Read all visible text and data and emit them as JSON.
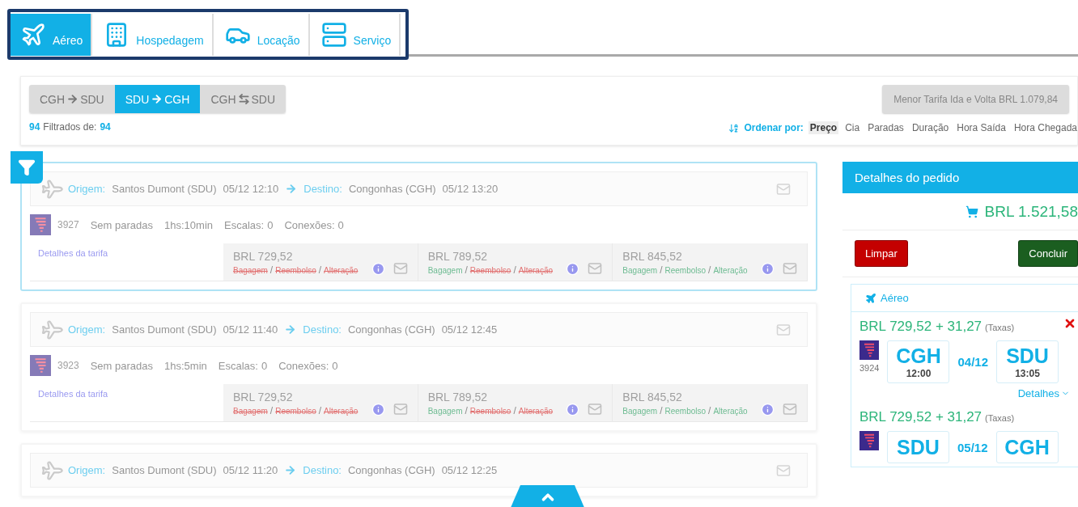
{
  "product_tabs": [
    {
      "label": "Aéreo",
      "kind": "plane",
      "selected": true
    },
    {
      "label": "Hospedagem",
      "kind": "building",
      "selected": false
    },
    {
      "label": "Locação",
      "kind": "car",
      "selected": false
    },
    {
      "label": "Serviço",
      "kind": "server",
      "selected": false
    }
  ],
  "routes": [
    {
      "from": "CGH",
      "to": "SDU",
      "kind": "oneway",
      "selected": false
    },
    {
      "from": "SDU",
      "to": "CGH",
      "kind": "oneway",
      "selected": true
    },
    {
      "from": "CGH",
      "to": "SDU",
      "kind": "roundtrip",
      "selected": false
    }
  ],
  "filter_count": {
    "shown": "94",
    "label": "Filtrados de:",
    "total": "94"
  },
  "lowest_fare_button": "Menor Tarifa Ida e Volta BRL 1.079,84",
  "sort": {
    "label": "Ordenar por:",
    "options": [
      {
        "label": "Preço",
        "selected": true
      },
      {
        "label": "Cia",
        "selected": false
      },
      {
        "label": "Paradas",
        "selected": false
      },
      {
        "label": "Duração",
        "selected": false
      },
      {
        "label": "Hora Saída",
        "selected": false
      },
      {
        "label": "Hora Chegada",
        "selected": false
      }
    ]
  },
  "flights": [
    {
      "selected": true,
      "origin_label": "Origem:",
      "origin": "Santos Dumont (SDU)",
      "departure": "05/12 12:10",
      "destination_label": "Destino:",
      "destination": "Congonhas (CGH)",
      "arrival": "05/12 13:20",
      "number": "3927",
      "stops": "Sem paradas",
      "duration": "1hs:10min",
      "layovers_label": "Escalas:",
      "layovers": "0",
      "connections_label": "Conexões:",
      "connections": "0",
      "fare_details": "Detalhes da tarifa",
      "fares": [
        {
          "price": "BRL 729,52",
          "separator": "/",
          "conditions": [
            {
              "label": "Bagagem",
              "included": false
            },
            {
              "label": "Reembolso",
              "included": false
            },
            {
              "label": "Alteração",
              "included": false
            }
          ]
        },
        {
          "price": "BRL 789,52",
          "separator": "/",
          "conditions": [
            {
              "label": "Bagagem",
              "included": true
            },
            {
              "label": "Reembolso",
              "included": false
            },
            {
              "label": "Alteração",
              "included": false
            }
          ]
        },
        {
          "price": "BRL 845,52",
          "separator": "/",
          "conditions": [
            {
              "label": "Bagagem",
              "included": true
            },
            {
              "label": "Reembolso",
              "included": true
            },
            {
              "label": "Alteração",
              "included": true
            }
          ]
        }
      ]
    },
    {
      "selected": false,
      "origin_label": "Origem:",
      "origin": "Santos Dumont (SDU)",
      "departure": "05/12 11:40",
      "destination_label": "Destino:",
      "destination": "Congonhas (CGH)",
      "arrival": "05/12 12:45",
      "number": "3923",
      "stops": "Sem paradas",
      "duration": "1hs:5min",
      "layovers_label": "Escalas:",
      "layovers": "0",
      "connections_label": "Conexões:",
      "connections": "0",
      "fare_details": "Detalhes da tarifa",
      "fares": [
        {
          "price": "BRL 729,52",
          "separator": "/",
          "conditions": [
            {
              "label": "Bagagem",
              "included": false
            },
            {
              "label": "Reembolso",
              "included": false
            },
            {
              "label": "Alteração",
              "included": false
            }
          ]
        },
        {
          "price": "BRL 789,52",
          "separator": "/",
          "conditions": [
            {
              "label": "Bagagem",
              "included": true
            },
            {
              "label": "Reembolso",
              "included": false
            },
            {
              "label": "Alteração",
              "included": false
            }
          ]
        },
        {
          "price": "BRL 845,52",
          "separator": "/",
          "conditions": [
            {
              "label": "Bagagem",
              "included": true
            },
            {
              "label": "Reembolso",
              "included": true
            },
            {
              "label": "Alteração",
              "included": true
            }
          ]
        }
      ]
    },
    {
      "selected": false,
      "origin_label": "Origem:",
      "origin": "Santos Dumont (SDU)",
      "departure": "05/12 11:20",
      "destination_label": "Destino:",
      "destination": "Congonhas (CGH)",
      "arrival": "05/12 12:25"
    }
  ],
  "order": {
    "title": "Detalhes do pedido",
    "total": "BRL 1.521,58",
    "clear_button": "Limpar",
    "finish_button": "Concluir",
    "section": "Aéreo",
    "items": [
      {
        "price": "BRL 729,52 + 31,27",
        "taxes": "(Taxas)",
        "number": "3924",
        "from": {
          "code": "CGH",
          "time": "12:00"
        },
        "date": "04/12",
        "to": {
          "code": "SDU",
          "time": "13:05"
        },
        "details": "Detalhes"
      },
      {
        "price": "BRL 729,52 + 31,27",
        "taxes": "(Taxas)",
        "from": {
          "code": "SDU"
        },
        "date": "05/12",
        "to": {
          "code": "CGH"
        }
      }
    ]
  }
}
